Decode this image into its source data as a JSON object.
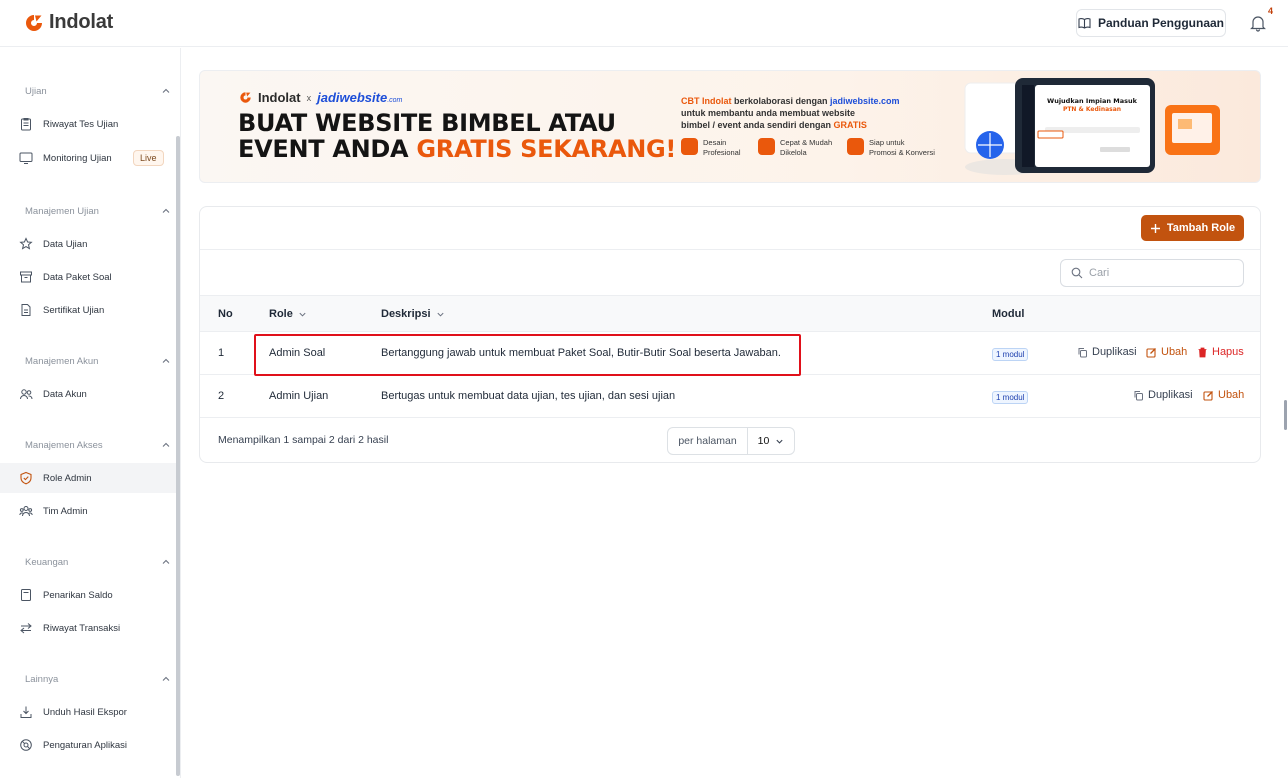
{
  "brand": {
    "name": "Indolat",
    "accent": "#ea580c"
  },
  "topbar": {
    "guide_label": "Panduan Penggunaan",
    "notification_count": "4"
  },
  "sidebar": {
    "sections": [
      {
        "title": "Ujian",
        "items": [
          {
            "label": "Riwayat Tes Ujian",
            "icon": "clipboard-icon"
          },
          {
            "label": "Monitoring Ujian",
            "icon": "monitor-icon",
            "badge": "Live"
          }
        ]
      },
      {
        "title": "Manajemen Ujian",
        "items": [
          {
            "label": "Data Ujian",
            "icon": "star-icon"
          },
          {
            "label": "Data Paket Soal",
            "icon": "archive-icon"
          },
          {
            "label": "Sertifikat Ujian",
            "icon": "document-icon"
          }
        ]
      },
      {
        "title": "Manajemen Akun",
        "items": [
          {
            "label": "Data Akun",
            "icon": "users-icon"
          }
        ]
      },
      {
        "title": "Manajemen Akses",
        "items": [
          {
            "label": "Role Admin",
            "icon": "shield-check-icon",
            "active": true
          },
          {
            "label": "Tim Admin",
            "icon": "team-icon"
          }
        ]
      },
      {
        "title": "Keuangan",
        "items": [
          {
            "label": "Penarikan Saldo",
            "icon": "receipt-icon"
          },
          {
            "label": "Riwayat Transaksi",
            "icon": "transfer-icon"
          }
        ]
      },
      {
        "title": "Lainnya",
        "items": [
          {
            "label": "Unduh Hasil Ekspor",
            "icon": "download-icon"
          },
          {
            "label": "Pengaturan Aplikasi",
            "icon": "settings-icon"
          }
        ]
      }
    ]
  },
  "banner": {
    "brand": "Indolat",
    "x": "x",
    "partner": "jadiwebsite",
    "partner_suffix": ".com",
    "headline_1": "BUAT WEBSITE BIMBEL ATAU",
    "headline_2_a": "EVENT ANDA ",
    "headline_2_b": "GRATIS SEKARANG!",
    "desc_a": "CBT Indolat",
    "desc_b": " berkolaborasi dengan ",
    "desc_c": "jadiwebsite.com",
    "desc_d": "untuk membantu anda membuat website",
    "desc_e": "bimbel / event anda sendiri dengan ",
    "desc_f": "GRATIS",
    "features": [
      {
        "line1": "Desain",
        "line2": "Profesional"
      },
      {
        "line1": "Cepat & Mudah",
        "line2": "Dikelola"
      },
      {
        "line1": "Siap untuk",
        "line2": "Promosi & Konversi"
      }
    ],
    "art_title_1": "Wujudkan Impian Masuk",
    "art_title_2": "PTN & Kedinasan"
  },
  "card": {
    "add_label": "Tambah Role",
    "search_placeholder": "Cari",
    "columns": {
      "no": "No",
      "role": "Role",
      "desc": "Deskripsi",
      "modul": "Modul"
    },
    "rows": [
      {
        "no": "1",
        "role": "Admin Soal",
        "desc": "Bertanggung jawab untuk membuat Paket Soal, Butir-Butir Soal beserta Jawaban.",
        "modul": "1 modul",
        "dup": "Duplikasi",
        "edit": "Ubah",
        "del": "Hapus"
      },
      {
        "no": "2",
        "role": "Admin Ujian",
        "desc": "Bertugas untuk membuat data ujian, tes ujian, dan sesi ujian",
        "modul": "1 modul",
        "dup": "Duplikasi",
        "edit": "Ubah"
      }
    ],
    "footer": "Menampilkan 1 sampai 2 dari 2 hasil",
    "per_page_label": "per halaman",
    "per_page_value": "10"
  }
}
